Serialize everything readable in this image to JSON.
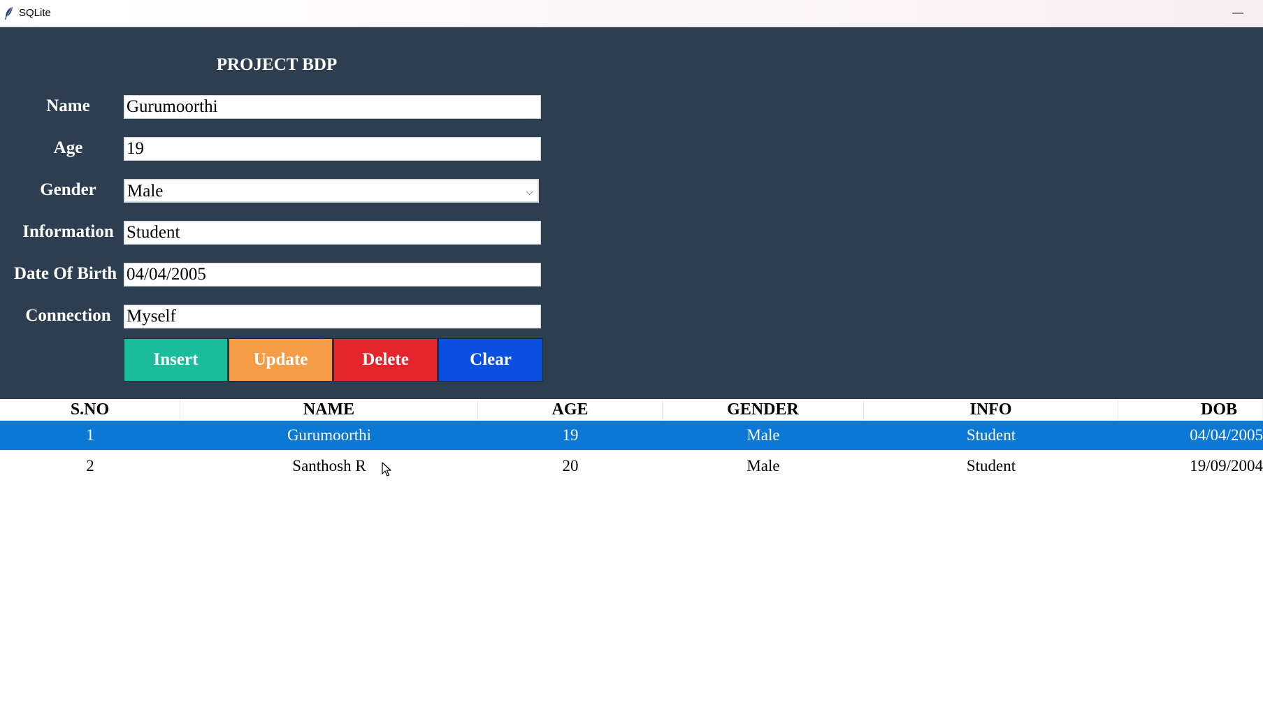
{
  "window": {
    "title": "SQLite",
    "minimize_glyph": "—",
    "icon": "feather-icon"
  },
  "form": {
    "title": "PROJECT BDP",
    "fields": [
      {
        "label": "Name",
        "value": "Gurumoorthi"
      },
      {
        "label": "Age",
        "value": "19"
      },
      {
        "label": "Gender",
        "value": "Male"
      },
      {
        "label": "Information",
        "value": "Student"
      },
      {
        "label": "Date Of Birth",
        "value": "04/04/2005"
      },
      {
        "label": "Connection",
        "value": "Myself"
      }
    ],
    "buttons": {
      "insert": "Insert",
      "update": "Update",
      "delete": "Delete",
      "clear": "Clear"
    }
  },
  "table": {
    "columns": [
      "S.NO",
      "NAME",
      "AGE",
      "GENDER",
      "INFO",
      "DOB"
    ],
    "rows": [
      [
        "1",
        "Gurumoorthi",
        "19",
        "Male",
        "Student",
        "04/04/2005"
      ],
      [
        "2",
        "Santhosh R",
        "20",
        "Male",
        "Student",
        "19/09/2004"
      ]
    ],
    "selected_row": 0
  },
  "colors": {
    "panel_bg": "#2c3e50",
    "insert": "#1abc9c",
    "update": "#f59c46",
    "delete": "#e4252c",
    "clear": "#0a4fe0",
    "selection": "#0a78d4"
  }
}
